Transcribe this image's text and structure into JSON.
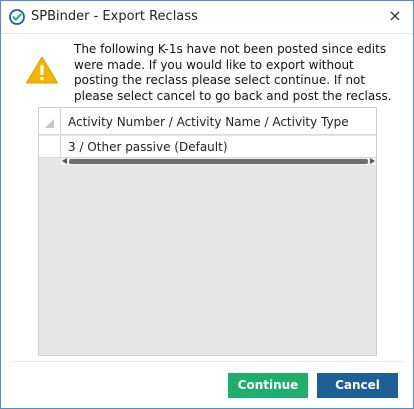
{
  "window": {
    "title": "SPBinder - Export Reclass",
    "close_glyph": "×",
    "app_icon": "check-badge-icon"
  },
  "warning_icon": "warning-triangle-icon",
  "message": "The following K-1s have not been posted since edits were made. If you would like to export without posting the reclass please select continue. If not please select cancel to go back and post the reclass.",
  "grid": {
    "column_header": "Activity Number / Activity Name / Activity Type",
    "rows": [
      {
        "value": "3 / Other passive (Default)"
      }
    ]
  },
  "buttons": {
    "continue_label": "Continue",
    "cancel_label": "Cancel"
  },
  "colors": {
    "continue": "#1fae6c",
    "cancel": "#1f5f97",
    "warning": "#f2b600",
    "border": "#4a8fd0"
  }
}
